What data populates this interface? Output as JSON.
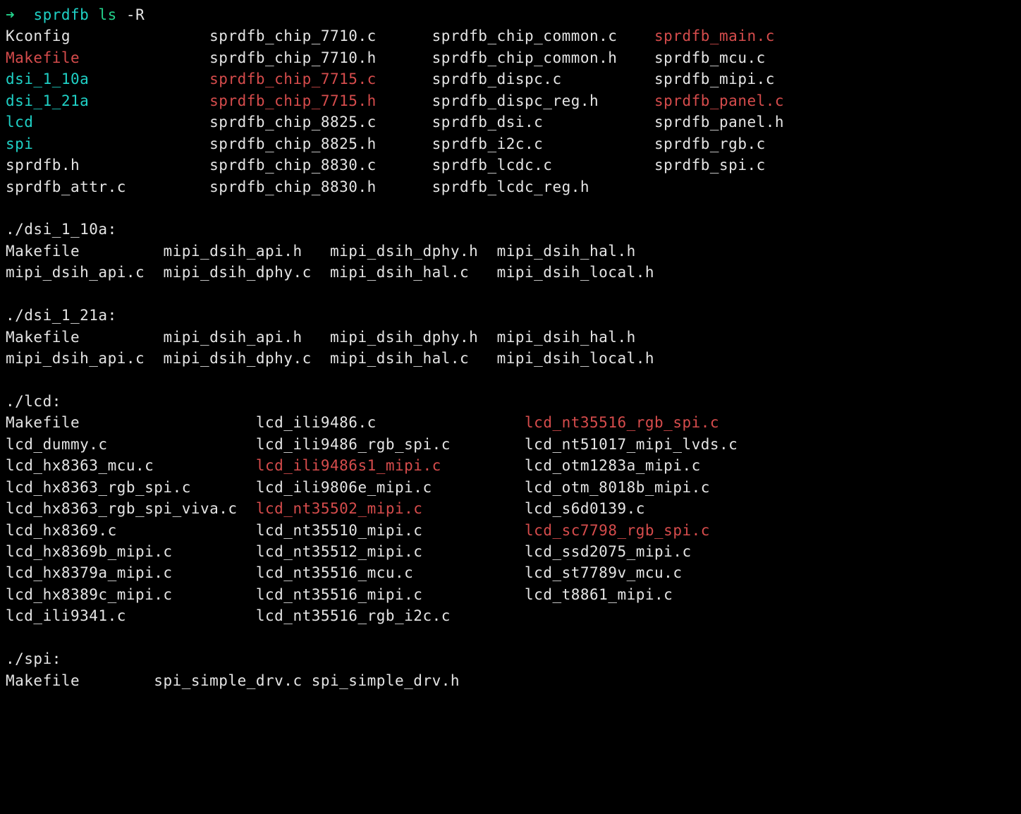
{
  "prompt": {
    "arrow": "➜",
    "cwd": "sprdfb",
    "cmd": "ls",
    "flags": "-R"
  },
  "sections": [
    {
      "header": null,
      "cols": 4,
      "widths": [
        22,
        24,
        24,
        0
      ],
      "rows": [
        [
          {
            "t": "Kconfig",
            "c": "plain"
          },
          {
            "t": "sprdfb_chip_7710.c",
            "c": "plain"
          },
          {
            "t": "sprdfb_chip_common.c",
            "c": "plain"
          },
          {
            "t": "sprdfb_main.c",
            "c": "hl"
          }
        ],
        [
          {
            "t": "Makefile",
            "c": "hl"
          },
          {
            "t": "sprdfb_chip_7710.h",
            "c": "plain"
          },
          {
            "t": "sprdfb_chip_common.h",
            "c": "plain"
          },
          {
            "t": "sprdfb_mcu.c",
            "c": "plain"
          }
        ],
        [
          {
            "t": "dsi_1_10a",
            "c": "dir"
          },
          {
            "t": "sprdfb_chip_7715.c",
            "c": "hl"
          },
          {
            "t": "sprdfb_dispc.c",
            "c": "plain"
          },
          {
            "t": "sprdfb_mipi.c",
            "c": "plain"
          }
        ],
        [
          {
            "t": "dsi_1_21a",
            "c": "dir"
          },
          {
            "t": "sprdfb_chip_7715.h",
            "c": "hl"
          },
          {
            "t": "sprdfb_dispc_reg.h",
            "c": "plain"
          },
          {
            "t": "sprdfb_panel.c",
            "c": "hl"
          }
        ],
        [
          {
            "t": "lcd",
            "c": "dir"
          },
          {
            "t": "sprdfb_chip_8825.c",
            "c": "plain"
          },
          {
            "t": "sprdfb_dsi.c",
            "c": "plain"
          },
          {
            "t": "sprdfb_panel.h",
            "c": "plain"
          }
        ],
        [
          {
            "t": "spi",
            "c": "dir"
          },
          {
            "t": "sprdfb_chip_8825.h",
            "c": "plain"
          },
          {
            "t": "sprdfb_i2c.c",
            "c": "plain"
          },
          {
            "t": "sprdfb_rgb.c",
            "c": "plain"
          }
        ],
        [
          {
            "t": "sprdfb.h",
            "c": "plain"
          },
          {
            "t": "sprdfb_chip_8830.c",
            "c": "plain"
          },
          {
            "t": "sprdfb_lcdc.c",
            "c": "plain"
          },
          {
            "t": "sprdfb_spi.c",
            "c": "plain"
          }
        ],
        [
          {
            "t": "sprdfb_attr.c",
            "c": "plain"
          },
          {
            "t": "sprdfb_chip_8830.h",
            "c": "plain"
          },
          {
            "t": "sprdfb_lcdc_reg.h",
            "c": "plain"
          },
          {
            "t": "",
            "c": "plain"
          }
        ]
      ]
    },
    {
      "header": "./dsi_1_10a:",
      "cols": 4,
      "widths": [
        17,
        18,
        18,
        0
      ],
      "rows": [
        [
          {
            "t": "Makefile",
            "c": "plain"
          },
          {
            "t": "mipi_dsih_api.h",
            "c": "plain"
          },
          {
            "t": "mipi_dsih_dphy.h",
            "c": "plain"
          },
          {
            "t": "mipi_dsih_hal.h",
            "c": "plain"
          }
        ],
        [
          {
            "t": "mipi_dsih_api.c",
            "c": "plain"
          },
          {
            "t": "mipi_dsih_dphy.c",
            "c": "plain"
          },
          {
            "t": "mipi_dsih_hal.c",
            "c": "plain"
          },
          {
            "t": "mipi_dsih_local.h",
            "c": "plain"
          }
        ]
      ]
    },
    {
      "header": "./dsi_1_21a:",
      "cols": 4,
      "widths": [
        17,
        18,
        18,
        0
      ],
      "rows": [
        [
          {
            "t": "Makefile",
            "c": "plain"
          },
          {
            "t": "mipi_dsih_api.h",
            "c": "plain"
          },
          {
            "t": "mipi_dsih_dphy.h",
            "c": "plain"
          },
          {
            "t": "mipi_dsih_hal.h",
            "c": "plain"
          }
        ],
        [
          {
            "t": "mipi_dsih_api.c",
            "c": "plain"
          },
          {
            "t": "mipi_dsih_dphy.c",
            "c": "plain"
          },
          {
            "t": "mipi_dsih_hal.c",
            "c": "plain"
          },
          {
            "t": "mipi_dsih_local.h",
            "c": "plain"
          }
        ]
      ]
    },
    {
      "header": "./lcd:",
      "cols": 3,
      "widths": [
        27,
        29,
        0
      ],
      "rows": [
        [
          {
            "t": "Makefile",
            "c": "plain"
          },
          {
            "t": "lcd_ili9486.c",
            "c": "plain"
          },
          {
            "t": "lcd_nt35516_rgb_spi.c",
            "c": "hl"
          }
        ],
        [
          {
            "t": "lcd_dummy.c",
            "c": "plain"
          },
          {
            "t": "lcd_ili9486_rgb_spi.c",
            "c": "plain"
          },
          {
            "t": "lcd_nt51017_mipi_lvds.c",
            "c": "plain"
          }
        ],
        [
          {
            "t": "lcd_hx8363_mcu.c",
            "c": "plain"
          },
          {
            "t": "lcd_ili9486s1_mipi.c",
            "c": "hl"
          },
          {
            "t": "lcd_otm1283a_mipi.c",
            "c": "plain"
          }
        ],
        [
          {
            "t": "lcd_hx8363_rgb_spi.c",
            "c": "plain"
          },
          {
            "t": "lcd_ili9806e_mipi.c",
            "c": "plain"
          },
          {
            "t": "lcd_otm_8018b_mipi.c",
            "c": "plain"
          }
        ],
        [
          {
            "t": "lcd_hx8363_rgb_spi_viva.c",
            "c": "plain"
          },
          {
            "t": "lcd_nt35502_mipi.c",
            "c": "hl"
          },
          {
            "t": "lcd_s6d0139.c",
            "c": "plain"
          }
        ],
        [
          {
            "t": "lcd_hx8369.c",
            "c": "plain"
          },
          {
            "t": "lcd_nt35510_mipi.c",
            "c": "plain"
          },
          {
            "t": "lcd_sc7798_rgb_spi.c",
            "c": "hl"
          }
        ],
        [
          {
            "t": "lcd_hx8369b_mipi.c",
            "c": "plain"
          },
          {
            "t": "lcd_nt35512_mipi.c",
            "c": "plain"
          },
          {
            "t": "lcd_ssd2075_mipi.c",
            "c": "plain"
          }
        ],
        [
          {
            "t": "lcd_hx8379a_mipi.c",
            "c": "plain"
          },
          {
            "t": "lcd_nt35516_mcu.c",
            "c": "plain"
          },
          {
            "t": "lcd_st7789v_mcu.c",
            "c": "plain"
          }
        ],
        [
          {
            "t": "lcd_hx8389c_mipi.c",
            "c": "plain"
          },
          {
            "t": "lcd_nt35516_mipi.c",
            "c": "plain"
          },
          {
            "t": "lcd_t8861_mipi.c",
            "c": "plain"
          }
        ],
        [
          {
            "t": "lcd_ili9341.c",
            "c": "plain"
          },
          {
            "t": "lcd_nt35516_rgb_i2c.c",
            "c": "plain"
          },
          {
            "t": "",
            "c": "plain"
          }
        ]
      ]
    },
    {
      "header": "./spi:",
      "cols": 3,
      "widths": [
        16,
        17,
        0
      ],
      "rows": [
        [
          {
            "t": "Makefile",
            "c": "plain"
          },
          {
            "t": "spi_simple_drv.c",
            "c": "plain"
          },
          {
            "t": "spi_simple_drv.h",
            "c": "plain"
          }
        ]
      ]
    }
  ]
}
